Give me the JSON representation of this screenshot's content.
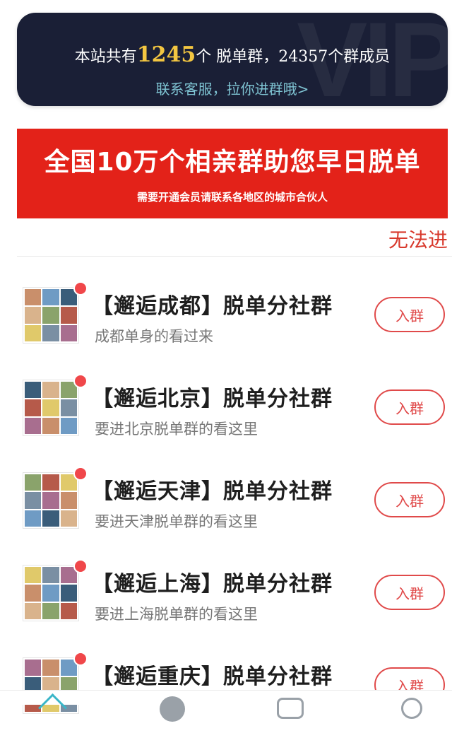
{
  "stats": {
    "prefix": "本站共有",
    "group_count": "1245",
    "unit_groups": "个 脱单群，",
    "member_count": "24357",
    "unit_members": "个群成员",
    "contact_link": "联系客服，拉你进群哦>",
    "watermark": "VIP"
  },
  "promo": {
    "title": "全国10万个相亲群助您早日脱单",
    "subtitle": "需要开通会员请联系各地区的城市合伙人"
  },
  "marquee": "无法进",
  "groups": [
    {
      "title": "【邂逅成都】脱单分社群",
      "desc": "成都单身的看过来",
      "join_label": "入群"
    },
    {
      "title": "【邂逅北京】脱单分社群",
      "desc": "要进北京脱单群的看这里",
      "join_label": "入群"
    },
    {
      "title": "【邂逅天津】脱单分社群",
      "desc": "要进天津脱单群的看这里",
      "join_label": "入群"
    },
    {
      "title": "【邂逅上海】脱单分社群",
      "desc": "要进上海脱单群的看这里",
      "join_label": "入群"
    },
    {
      "title": "【邂逅重庆】脱单分社群",
      "desc": "",
      "join_label": "入群"
    }
  ],
  "colors": {
    "accent_red": "#e32219",
    "button_red": "#e04a4a",
    "banner_dark": "#1a1f36",
    "gold": "#f3c641",
    "link_teal": "#7fc4d3"
  },
  "nav_icons": [
    "home-icon",
    "discover-icon",
    "message-icon",
    "profile-icon"
  ]
}
